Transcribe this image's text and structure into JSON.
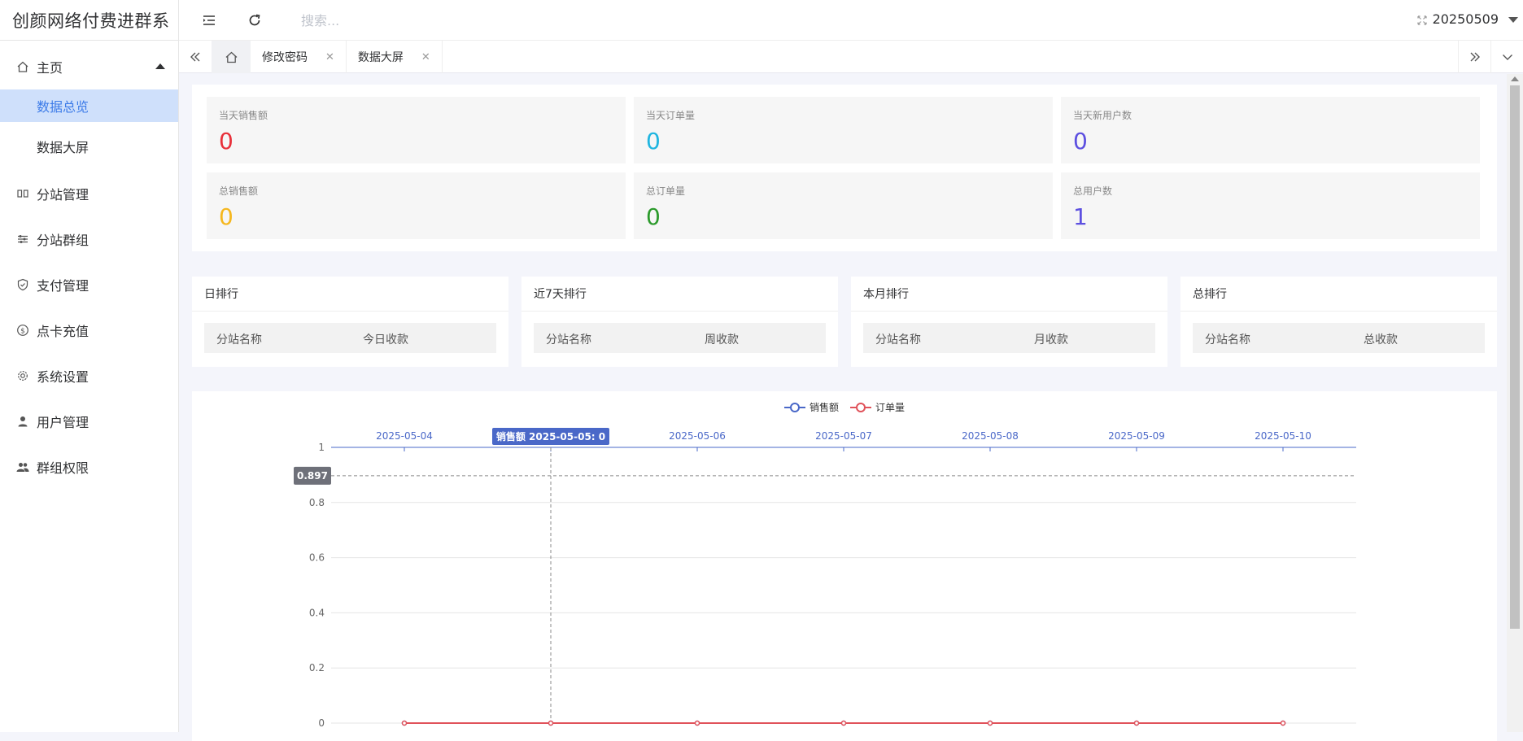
{
  "sidebar": {
    "brand": "创颜网络付费进群系",
    "menu": [
      {
        "label": "主页",
        "icon": "home-icon",
        "expanded": true,
        "children": [
          {
            "label": "数据总览",
            "active": true
          },
          {
            "label": "数据大屏",
            "active": false
          }
        ]
      },
      {
        "label": "分站管理",
        "icon": "columns-icon"
      },
      {
        "label": "分站群组",
        "icon": "sliders-icon"
      },
      {
        "label": "支付管理",
        "icon": "shield-check-icon"
      },
      {
        "label": "点卡充值",
        "icon": "dollar-circle-icon"
      },
      {
        "label": "系统设置",
        "icon": "gear-icon"
      },
      {
        "label": "用户管理",
        "icon": "user-icon"
      },
      {
        "label": "群组权限",
        "icon": "users-icon"
      }
    ]
  },
  "header": {
    "search_placeholder": "搜索...",
    "username": "20250509"
  },
  "tabs": [
    {
      "label": "修改密码",
      "closable": true
    },
    {
      "label": "数据大屏",
      "closable": true
    }
  ],
  "stats": [
    {
      "label": "当天销售额",
      "value": "0",
      "color": "#e8303a"
    },
    {
      "label": "当天订单量",
      "value": "0",
      "color": "#1fb5e0"
    },
    {
      "label": "当天新用户数",
      "value": "0",
      "color": "#5c4fe0"
    },
    {
      "label": "总销售额",
      "value": "0",
      "color": "#f5b71e"
    },
    {
      "label": "总订单量",
      "value": "0",
      "color": "#2b9a2b"
    },
    {
      "label": "总用户数",
      "value": "1",
      "color": "#5c4fe0"
    }
  ],
  "rankings": [
    {
      "title": "日排行",
      "col1": "分站名称",
      "col2": "今日收款"
    },
    {
      "title": "近7天排行",
      "col1": "分站名称",
      "col2": "周收款"
    },
    {
      "title": "本月排行",
      "col1": "分站名称",
      "col2": "月收款"
    },
    {
      "title": "总排行",
      "col1": "分站名称",
      "col2": "总收款"
    }
  ],
  "chart_data": {
    "type": "line",
    "x": [
      "2025-05-04",
      "2025-05-05",
      "2025-05-06",
      "2025-05-07",
      "2025-05-08",
      "2025-05-09",
      "2025-05-10"
    ],
    "series": [
      {
        "name": "销售额",
        "values": [
          0,
          0,
          0,
          0,
          0,
          0,
          0
        ],
        "color": "#4a68c8"
      },
      {
        "name": "订单量",
        "values": [
          0,
          0,
          0,
          0,
          0,
          0,
          0
        ],
        "color": "#e0525a"
      }
    ],
    "ylim": [
      0,
      1
    ],
    "yticks": [
      "0",
      "0.2",
      "0.4",
      "0.6",
      "0.8",
      "1"
    ],
    "legend": "top-center",
    "tooltip": {
      "series": "销售额",
      "label": "2025-05-05: 0",
      "x_index": 1
    },
    "crosshair_value": "0.897",
    "crosshair_y": 0.897,
    "grid": true
  }
}
